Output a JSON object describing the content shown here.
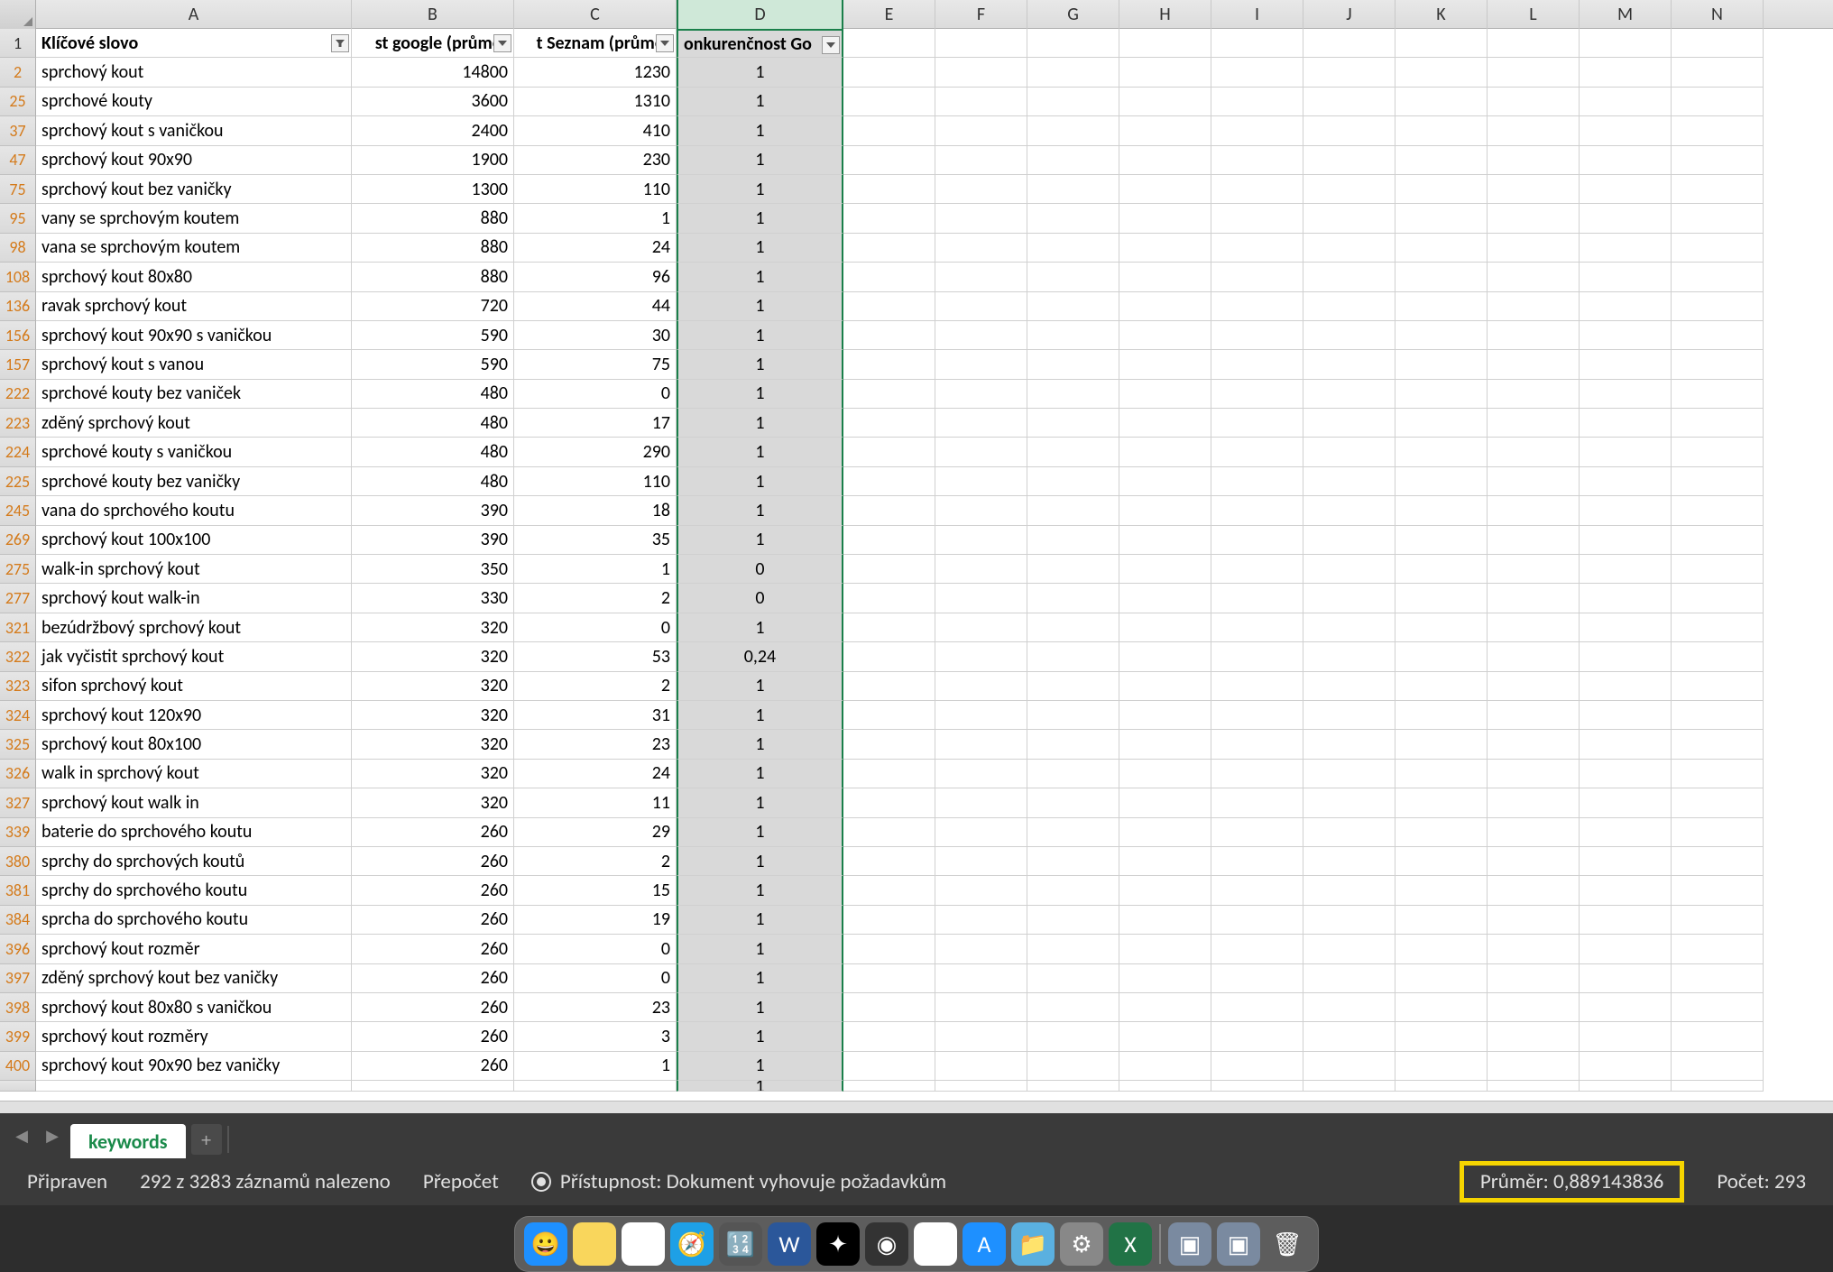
{
  "columns": [
    "A",
    "B",
    "C",
    "D",
    "E",
    "F",
    "G",
    "H",
    "I",
    "J",
    "K",
    "L",
    "M",
    "N"
  ],
  "headers": {
    "a": "Klíčové slovo",
    "b": "st google (průměr",
    "c": "t Seznam (průměr",
    "d": "onkurenčnost Go"
  },
  "rows": [
    {
      "n": "1",
      "header": true
    },
    {
      "n": "2",
      "a": "sprchový kout",
      "b": "14800",
      "c": "1230",
      "d": "1"
    },
    {
      "n": "25",
      "a": "sprchové kouty",
      "b": "3600",
      "c": "1310",
      "d": "1"
    },
    {
      "n": "37",
      "a": "sprchový kout s vaničkou",
      "b": "2400",
      "c": "410",
      "d": "1"
    },
    {
      "n": "47",
      "a": "sprchový kout 90x90",
      "b": "1900",
      "c": "230",
      "d": "1"
    },
    {
      "n": "75",
      "a": "sprchový kout bez vaničky",
      "b": "1300",
      "c": "110",
      "d": "1"
    },
    {
      "n": "95",
      "a": "vany se sprchovým koutem",
      "b": "880",
      "c": "1",
      "d": "1"
    },
    {
      "n": "98",
      "a": "vana se sprchovým koutem",
      "b": "880",
      "c": "24",
      "d": "1"
    },
    {
      "n": "108",
      "a": "sprchový kout 80x80",
      "b": "880",
      "c": "96",
      "d": "1"
    },
    {
      "n": "136",
      "a": "ravak sprchový kout",
      "b": "720",
      "c": "44",
      "d": "1"
    },
    {
      "n": "156",
      "a": "sprchový kout 90x90 s vaničkou",
      "b": "590",
      "c": "30",
      "d": "1"
    },
    {
      "n": "157",
      "a": "sprchový kout s vanou",
      "b": "590",
      "c": "75",
      "d": "1"
    },
    {
      "n": "222",
      "a": "sprchové kouty bez vaniček",
      "b": "480",
      "c": "0",
      "d": "1"
    },
    {
      "n": "223",
      "a": "zděný sprchový kout",
      "b": "480",
      "c": "17",
      "d": "1"
    },
    {
      "n": "224",
      "a": "sprchové kouty s vaničkou",
      "b": "480",
      "c": "290",
      "d": "1"
    },
    {
      "n": "225",
      "a": "sprchové kouty bez vaničky",
      "b": "480",
      "c": "110",
      "d": "1"
    },
    {
      "n": "245",
      "a": "vana do sprchového koutu",
      "b": "390",
      "c": "18",
      "d": "1"
    },
    {
      "n": "269",
      "a": "sprchový kout 100x100",
      "b": "390",
      "c": "35",
      "d": "1"
    },
    {
      "n": "275",
      "a": "walk-in sprchový kout",
      "b": "350",
      "c": "1",
      "d": "0"
    },
    {
      "n": "277",
      "a": "sprchový kout walk-in",
      "b": "330",
      "c": "2",
      "d": "0"
    },
    {
      "n": "321",
      "a": "bezúdržbový sprchový kout",
      "b": "320",
      "c": "0",
      "d": "1"
    },
    {
      "n": "322",
      "a": "jak vyčistit sprchový kout",
      "b": "320",
      "c": "53",
      "d": "0,24"
    },
    {
      "n": "323",
      "a": "sifon sprchový kout",
      "b": "320",
      "c": "2",
      "d": "1"
    },
    {
      "n": "324",
      "a": "sprchový kout 120x90",
      "b": "320",
      "c": "31",
      "d": "1"
    },
    {
      "n": "325",
      "a": "sprchový kout 80x100",
      "b": "320",
      "c": "23",
      "d": "1"
    },
    {
      "n": "326",
      "a": "walk in sprchový kout",
      "b": "320",
      "c": "24",
      "d": "1"
    },
    {
      "n": "327",
      "a": "sprchový kout walk in",
      "b": "320",
      "c": "11",
      "d": "1"
    },
    {
      "n": "339",
      "a": "baterie do sprchového koutu",
      "b": "260",
      "c": "29",
      "d": "1"
    },
    {
      "n": "380",
      "a": "sprchy do sprchových koutů",
      "b": "260",
      "c": "2",
      "d": "1"
    },
    {
      "n": "381",
      "a": "sprchy do sprchového koutu",
      "b": "260",
      "c": "15",
      "d": "1"
    },
    {
      "n": "384",
      "a": "sprcha do sprchového koutu",
      "b": "260",
      "c": "19",
      "d": "1"
    },
    {
      "n": "396",
      "a": "sprchový kout rozměr",
      "b": "260",
      "c": "0",
      "d": "1"
    },
    {
      "n": "397",
      "a": "zděný sprchový kout bez vaničky",
      "b": "260",
      "c": "0",
      "d": "1"
    },
    {
      "n": "398",
      "a": "sprchový kout 80x80 s vaničkou",
      "b": "260",
      "c": "23",
      "d": "1"
    },
    {
      "n": "399",
      "a": "sprchový kout rozměry",
      "b": "260",
      "c": "3",
      "d": "1"
    },
    {
      "n": "400",
      "a": "sprchový kout 90x90 bez vaničky",
      "b": "260",
      "c": "1",
      "d": "1"
    },
    {
      "n": "",
      "a": "",
      "b": "",
      "c": "",
      "d": "1",
      "partial": true
    }
  ],
  "sheet_tab": "keywords",
  "status": {
    "ready": "Připraven",
    "records": "292 z 3283 záznamů nalezeno",
    "recalc": "Přepočet",
    "a11y": "Přístupnost: Dokument vyhovuje požadavkům",
    "avg": "Průměr: 0,889143836",
    "count": "Počet: 293"
  },
  "dock": [
    {
      "name": "finder",
      "bg": "#1e90ff",
      "glyph": "😀"
    },
    {
      "name": "notes",
      "bg": "#f9d65c",
      "glyph": ""
    },
    {
      "name": "chrome",
      "bg": "#fff",
      "glyph": "◎"
    },
    {
      "name": "safari",
      "bg": "#1ea0e6",
      "glyph": "🧭"
    },
    {
      "name": "calculator",
      "bg": "#555",
      "glyph": "🔢"
    },
    {
      "name": "word",
      "bg": "#2b579a",
      "glyph": "W"
    },
    {
      "name": "app1",
      "bg": "#000",
      "glyph": "✦"
    },
    {
      "name": "app2",
      "bg": "#333",
      "glyph": "◉"
    },
    {
      "name": "photos",
      "bg": "#fff",
      "glyph": "❁"
    },
    {
      "name": "appstore",
      "bg": "#1e90ff",
      "glyph": "A"
    },
    {
      "name": "folder",
      "bg": "#5ab0e0",
      "glyph": "📁"
    },
    {
      "name": "settings",
      "bg": "#888",
      "glyph": "⚙"
    },
    {
      "name": "excel",
      "bg": "#217346",
      "glyph": "X"
    },
    {
      "name": "app3",
      "bg": "#7a8aa0",
      "glyph": "▣"
    },
    {
      "name": "app4",
      "bg": "#7a8aa0",
      "glyph": "▣"
    },
    {
      "name": "trash",
      "bg": "transparent",
      "glyph": "🗑"
    }
  ]
}
